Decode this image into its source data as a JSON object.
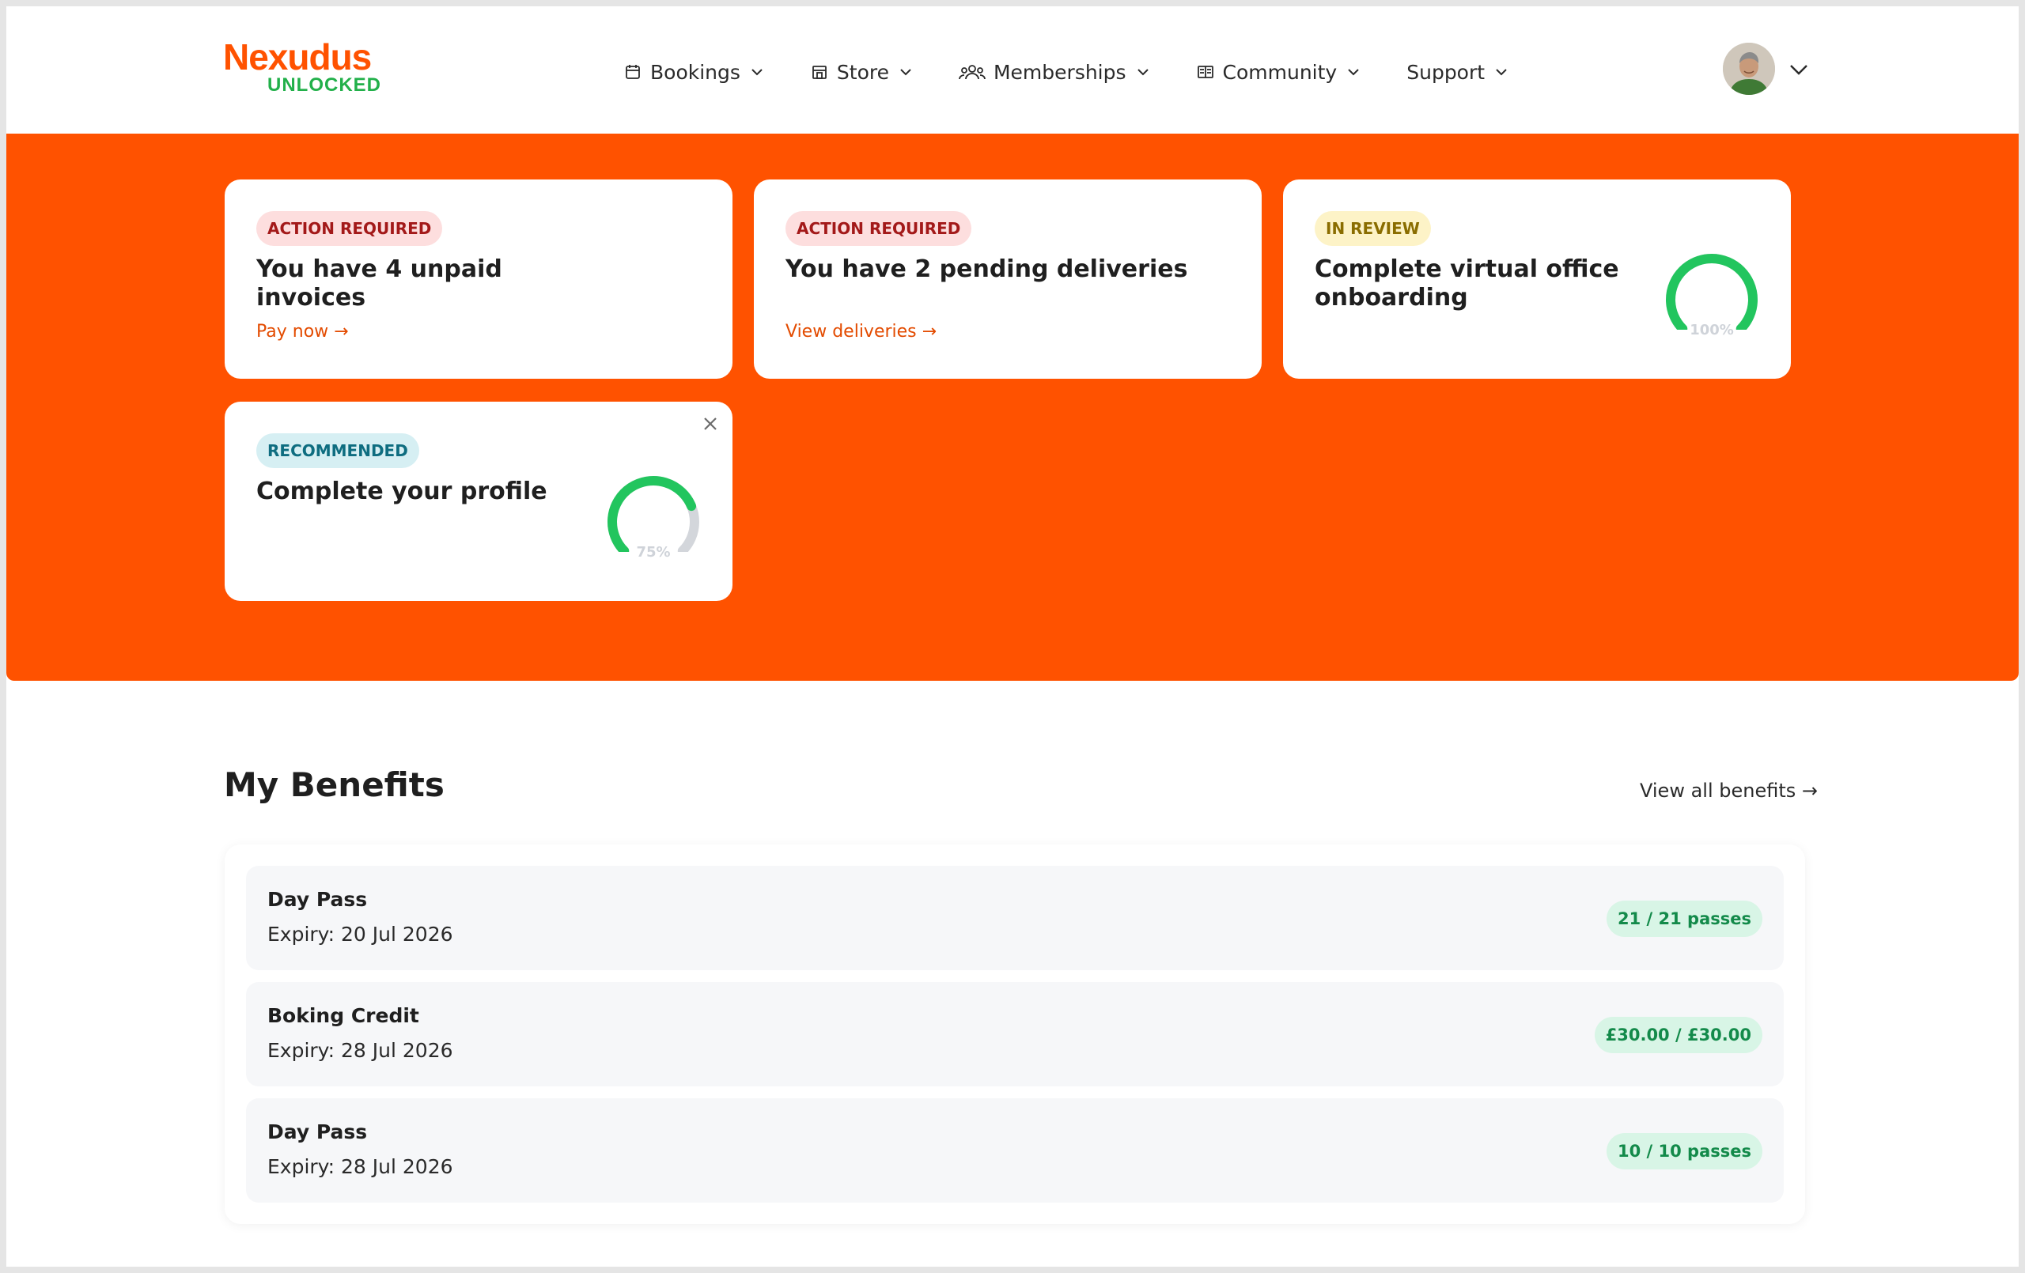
{
  "brand": {
    "name": "Nexudus",
    "sub": "UNLOCKED",
    "primary_color": "#ff5200",
    "accent_color": "#22b04a"
  },
  "nav": {
    "items": [
      {
        "label": "Bookings",
        "icon": "calendar-icon"
      },
      {
        "label": "Store",
        "icon": "store-icon"
      },
      {
        "label": "Memberships",
        "icon": "people-icon"
      },
      {
        "label": "Community",
        "icon": "newspaper-icon"
      },
      {
        "label": "Support",
        "icon": ""
      }
    ]
  },
  "user": {
    "avatar": "avatar",
    "menu_icon": "chevron-down-icon"
  },
  "cards": [
    {
      "badge": "ACTION REQUIRED",
      "title": "You have 4 unpaid invoices",
      "link": "Pay now →"
    },
    {
      "badge": "ACTION REQUIRED",
      "title": "You have 2 pending deliveries",
      "link": "View deliveries →"
    },
    {
      "badge": "IN REVIEW",
      "title": "Complete virtual office onboarding",
      "progress_label": "100%",
      "progress": 1.0
    },
    {
      "badge": "RECOMMENDED",
      "title": "Complete your profile",
      "progress_label": "75%",
      "progress": 0.75,
      "close_icon": "close-icon"
    }
  ],
  "benefits": {
    "title": "My Benefits",
    "view_all": "View all benefits →",
    "items": [
      {
        "name": "Day Pass",
        "expiry": "Expiry: 20 Jul 2026",
        "amount": "21 / 21 passes"
      },
      {
        "name": "Boking Credit",
        "expiry": "Expiry: 28 Jul 2026",
        "amount": "£30.00 / £30.00"
      },
      {
        "name": "Day Pass",
        "expiry": "Expiry: 28 Jul 2026",
        "amount": "10 / 10 passes"
      }
    ]
  },
  "colors": {
    "gauge_fill": "#22c55e",
    "gauge_track": "#d3d6db"
  }
}
